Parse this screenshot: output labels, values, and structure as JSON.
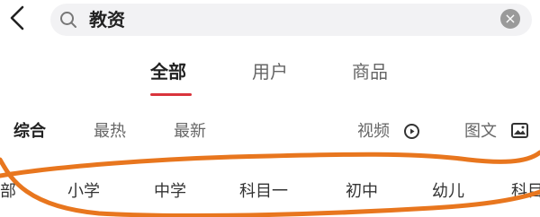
{
  "search": {
    "query": "教资"
  },
  "tabs": [
    {
      "label": "全部",
      "active": true
    },
    {
      "label": "用户",
      "active": false
    },
    {
      "label": "商品",
      "active": false
    }
  ],
  "filters": [
    {
      "label": "综合",
      "active": true
    },
    {
      "label": "最热",
      "active": false
    },
    {
      "label": "最新",
      "active": false
    },
    {
      "label": "视频",
      "icon": "play-circle-icon"
    },
    {
      "label": "图文",
      "icon": "image-icon"
    }
  ],
  "chips": [
    "部",
    "小学",
    "中学",
    "科目一",
    "初中",
    "幼儿",
    "科目"
  ],
  "colors": {
    "accent": "#d9343c",
    "annotation": "#e8761e",
    "search_bg": "#f2f2f4"
  },
  "icons": {
    "back": "chevron-left-icon",
    "search": "search-icon",
    "clear": "clear-circle-icon"
  }
}
